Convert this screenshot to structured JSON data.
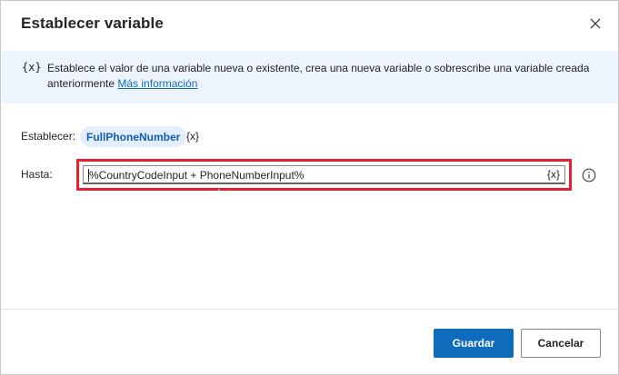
{
  "dialog": {
    "title": "Establecer variable",
    "close_icon": "close-icon"
  },
  "info": {
    "icon_text": "{x}",
    "text": "Establece el valor de una variable nueva o existente, crea una nueva variable o sobrescribe una variable creada anteriormente",
    "link_text": "Más información"
  },
  "form": {
    "set_label": "Establecer:",
    "variable_name": "FullPhoneNumber",
    "variable_picker": "{x}",
    "to_label": "Hasta:",
    "to_value": "%CountryCodeInput + PhoneNumberInput%",
    "to_picker": "{x}",
    "help_icon": "info-circle-icon"
  },
  "buttons": {
    "save": "Guardar",
    "cancel": "Cancelar"
  },
  "colors": {
    "accent": "#0f6cbd",
    "highlight_border": "#e5202f",
    "info_bar_bg": "#eef4fd",
    "chip_bg": "#e4eefc"
  }
}
